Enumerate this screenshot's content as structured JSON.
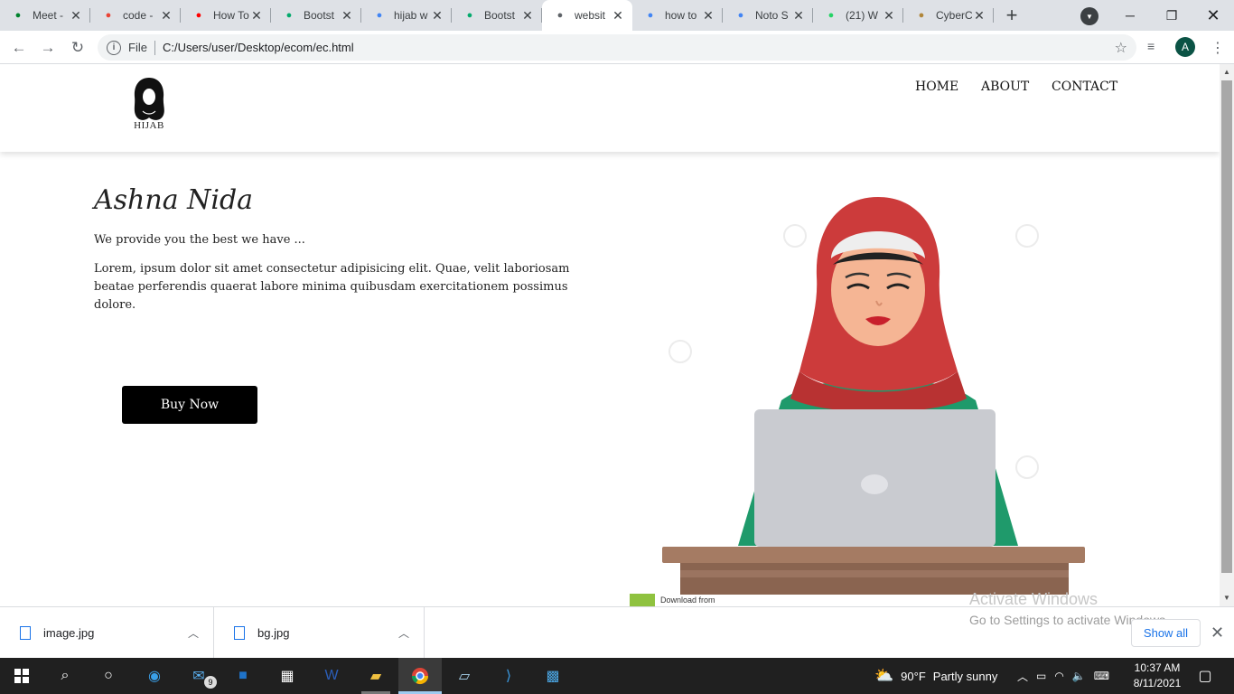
{
  "browser": {
    "tabs": [
      {
        "title": "Meet -",
        "icon": "google-meet-icon",
        "color": "#00832d"
      },
      {
        "title": "code -",
        "icon": "gmail-icon",
        "color": "#ea4335"
      },
      {
        "title": "How To",
        "icon": "youtube-icon",
        "color": "#ff0000"
      },
      {
        "title": "Bootst",
        "icon": "w3schools-icon",
        "color": "#04aa6d"
      },
      {
        "title": "hijab w",
        "icon": "google-icon",
        "color": "#4285f4"
      },
      {
        "title": "Bootst",
        "icon": "w3schools-icon",
        "color": "#04aa6d"
      },
      {
        "title": "websit",
        "icon": "globe-icon",
        "color": "#5f6368"
      },
      {
        "title": "how to",
        "icon": "google-icon",
        "color": "#4285f4"
      },
      {
        "title": "Noto S",
        "icon": "google-fonts-icon",
        "color": "#4285f4"
      },
      {
        "title": "(21) W",
        "icon": "whatsapp-icon",
        "color": "#25d366"
      },
      {
        "title": "CyberC",
        "icon": "cybercafe-icon",
        "color": "#b0863a"
      }
    ],
    "active_tab": 6,
    "address": {
      "scheme_label": "File",
      "url": "C:/Users/user/Desktop/ecom/ec.html"
    },
    "profile_initial": "A"
  },
  "site": {
    "logo_text": "HIJAB",
    "nav": [
      "HOME",
      "ABOUT",
      "CONTACT"
    ],
    "hero": {
      "title": "Ashna Nida",
      "subtitle": "We provide you the best we have ...",
      "body": "Lorem, ipsum dolor sit amet consectetur adipisicing elit. Quae, velit laboriosam beatae perferendis quaerat labore minima quibusdam exercitationem possimus dolore.",
      "button": "Buy Now"
    },
    "image_caption": "Download from"
  },
  "windows_watermark": {
    "line1": "Activate Windows",
    "line2": "Go to Settings to activate Windows."
  },
  "downloads": {
    "items": [
      "image.jpg",
      "bg.jpg"
    ],
    "show_all": "Show all"
  },
  "taskbar": {
    "mail_badge": "9",
    "weather": {
      "temp": "90°F",
      "condition": "Partly sunny"
    },
    "time": "10:37 AM",
    "date": "8/11/2021"
  }
}
